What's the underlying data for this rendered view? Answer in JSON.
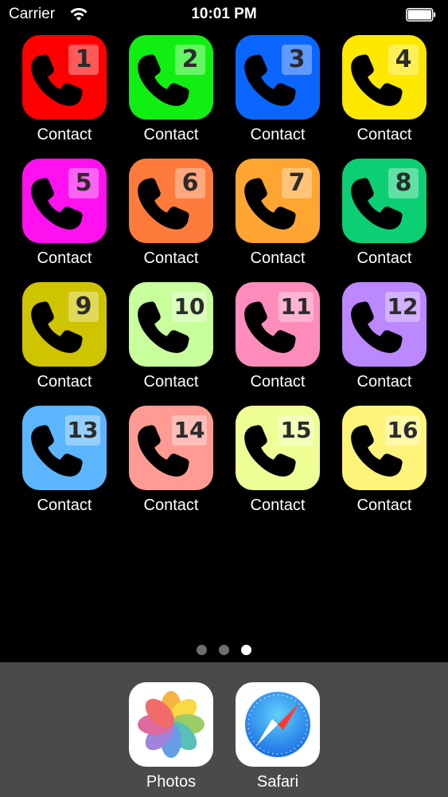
{
  "status_bar": {
    "carrier": "Carrier",
    "time": "10:01 PM",
    "wifi_icon": "wifi-icon",
    "battery_icon": "battery-icon"
  },
  "apps": [
    {
      "number": "1",
      "label": "Contact",
      "color": "#ff0000"
    },
    {
      "number": "2",
      "label": "Contact",
      "color": "#11ee11"
    },
    {
      "number": "3",
      "label": "Contact",
      "color": "#0a66ff"
    },
    {
      "number": "4",
      "label": "Contact",
      "color": "#ffe800"
    },
    {
      "number": "5",
      "label": "Contact",
      "color": "#ff10ee"
    },
    {
      "number": "6",
      "label": "Contact",
      "color": "#ff7b3c"
    },
    {
      "number": "7",
      "label": "Contact",
      "color": "#ffa531"
    },
    {
      "number": "8",
      "label": "Contact",
      "color": "#0ccf74"
    },
    {
      "number": "9",
      "label": "Contact",
      "color": "#cfc400"
    },
    {
      "number": "10",
      "label": "Contact",
      "color": "#c8ff9c"
    },
    {
      "number": "11",
      "label": "Contact",
      "color": "#ff8cba"
    },
    {
      "number": "12",
      "label": "Contact",
      "color": "#bb88ff"
    },
    {
      "number": "13",
      "label": "Contact",
      "color": "#5cb6ff"
    },
    {
      "number": "14",
      "label": "Contact",
      "color": "#ff9b93"
    },
    {
      "number": "15",
      "label": "Contact",
      "color": "#efff96"
    },
    {
      "number": "16",
      "label": "Contact",
      "color": "#fff47a"
    }
  ],
  "page_indicator": {
    "count": 3,
    "active": 3
  },
  "dock": [
    {
      "label": "Photos",
      "icon": "photos-icon"
    },
    {
      "label": "Safari",
      "icon": "safari-icon"
    }
  ]
}
